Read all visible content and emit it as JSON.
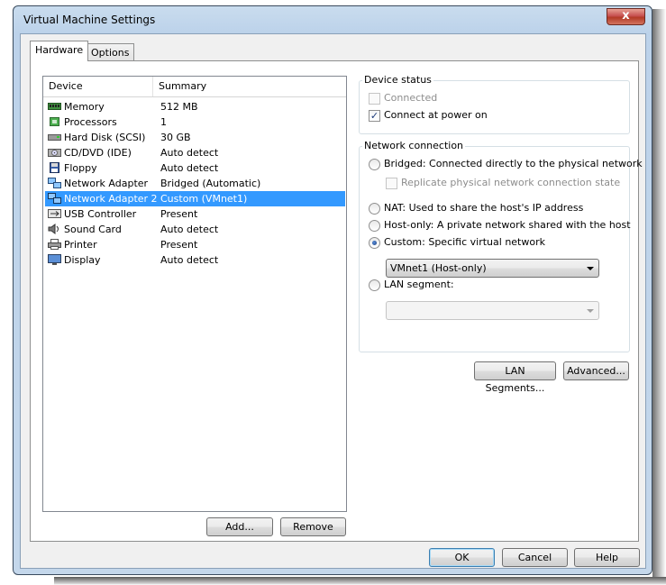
{
  "window": {
    "title": "Virtual Machine Settings",
    "close_glyph": "x"
  },
  "tabs": [
    {
      "label": "Hardware",
      "active": true
    },
    {
      "label": "Options",
      "active": false
    }
  ],
  "device_list": {
    "columns": [
      "Device",
      "Summary"
    ],
    "rows": [
      {
        "device": "Memory",
        "summary": "512 MB",
        "icon": "memory-icon"
      },
      {
        "device": "Processors",
        "summary": "1",
        "icon": "processor-icon"
      },
      {
        "device": "Hard Disk (SCSI)",
        "summary": "30 GB",
        "icon": "hard-disk-icon"
      },
      {
        "device": "CD/DVD (IDE)",
        "summary": "Auto detect",
        "icon": "cd-dvd-icon"
      },
      {
        "device": "Floppy",
        "summary": "Auto detect",
        "icon": "floppy-icon"
      },
      {
        "device": "Network Adapter",
        "summary": "Bridged (Automatic)",
        "icon": "network-adapter-icon"
      },
      {
        "device": "Network Adapter 2",
        "summary": "Custom (VMnet1)",
        "icon": "network-adapter-icon",
        "selected": true
      },
      {
        "device": "USB Controller",
        "summary": "Present",
        "icon": "usb-icon"
      },
      {
        "device": "Sound Card",
        "summary": "Auto detect",
        "icon": "sound-card-icon"
      },
      {
        "device": "Printer",
        "summary": "Present",
        "icon": "printer-icon"
      },
      {
        "device": "Display",
        "summary": "Auto detect",
        "icon": "display-icon"
      }
    ],
    "add_label": "Add...",
    "remove_label": "Remove"
  },
  "device_status": {
    "title": "Device status",
    "connected_label": "Connected",
    "connected_checked": false,
    "connected_enabled": false,
    "power_on_label": "Connect at power on",
    "power_on_checked": true,
    "check_glyph": "✓"
  },
  "network": {
    "title": "Network connection",
    "bridged_label": "Bridged: Connected directly to the physical network",
    "replicate_label": "Replicate physical network connection state",
    "nat_label": "NAT: Used to share the host's IP address",
    "hostonly_label": "Host-only: A private network shared with the host",
    "custom_label": "Custom: Specific virtual network",
    "custom_value": "VMnet1 (Host-only)",
    "lan_label": "LAN segment:",
    "lan_value": "",
    "selected": "custom",
    "lan_segments_label": "LAN Segments...",
    "advanced_label": "Advanced..."
  },
  "footer": {
    "ok_label": "OK",
    "cancel_label": "Cancel",
    "help_label": "Help"
  },
  "colors": {
    "selection": "#3399ff",
    "title_bar": "#bcd2ea",
    "close_button": "#c75050"
  }
}
